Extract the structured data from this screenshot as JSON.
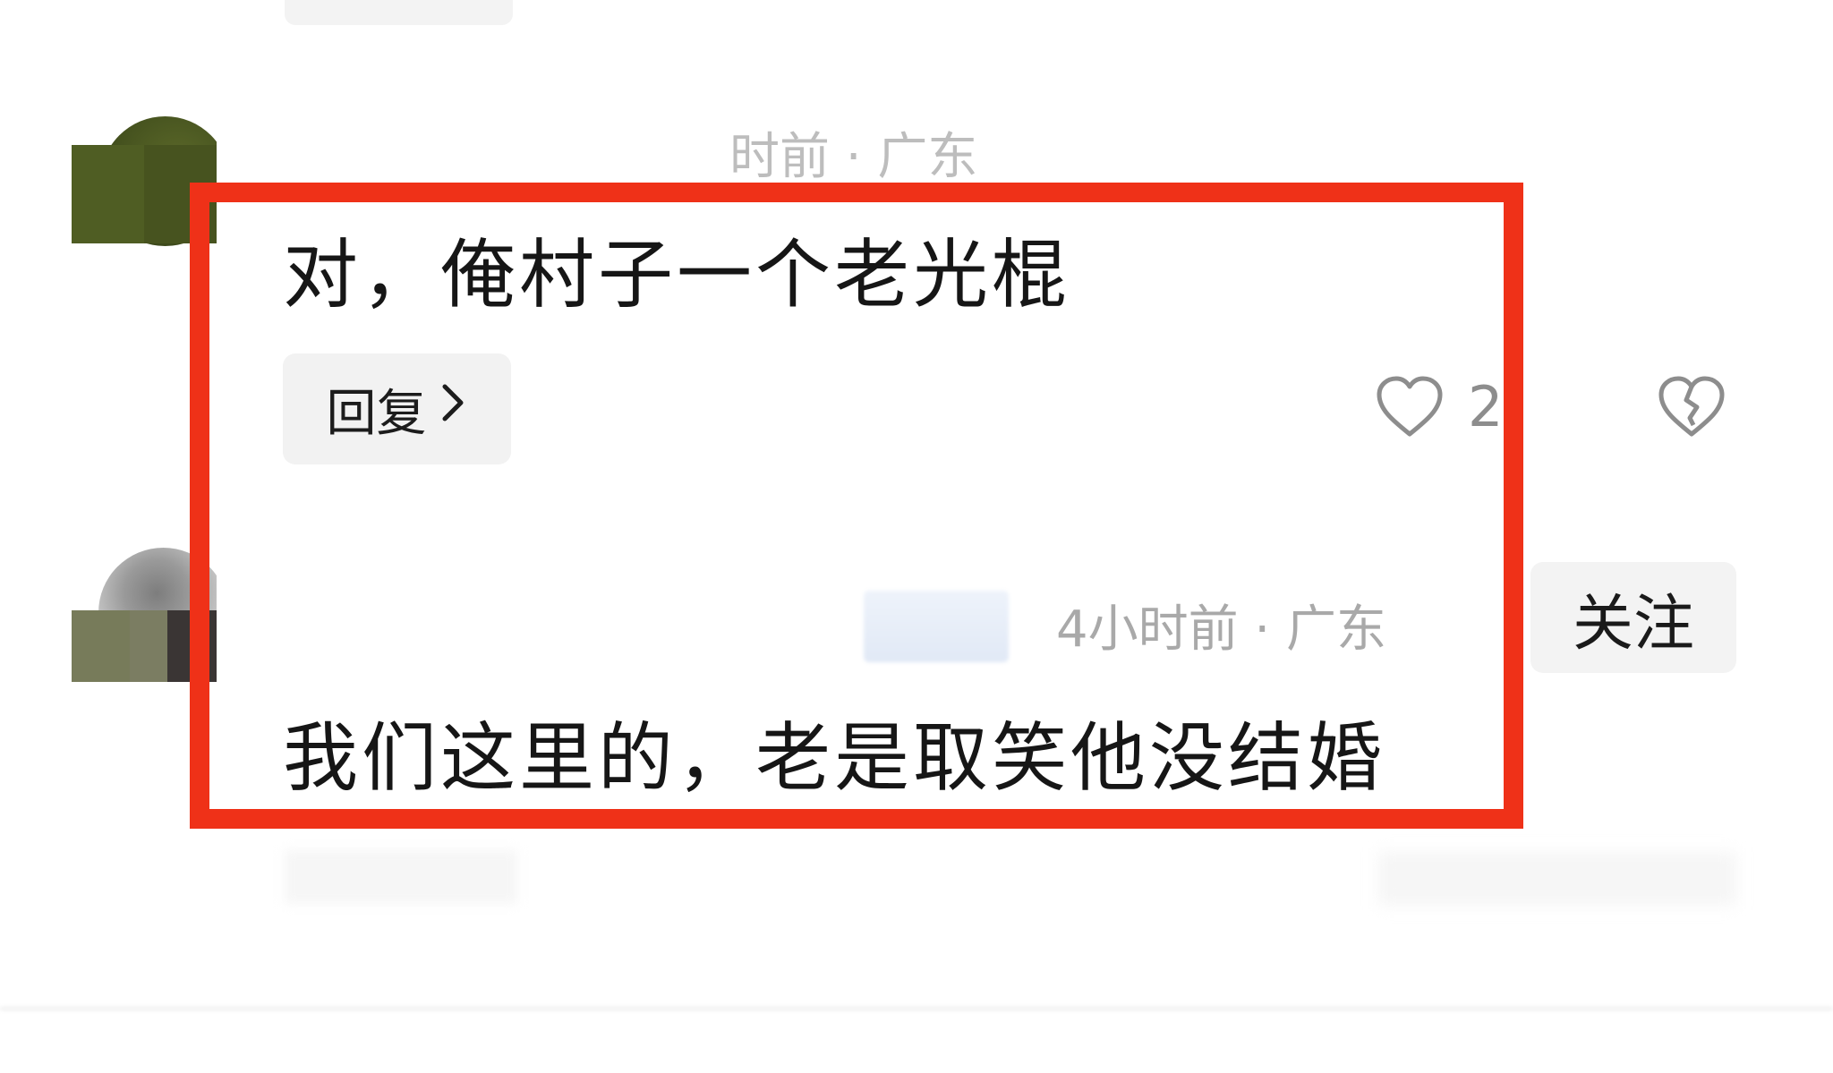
{
  "comments": [
    {
      "meta": "时前 · 广东",
      "text": "对，俺村子一个老光棍",
      "reply_label": "回复",
      "like_count": "2"
    },
    {
      "meta": "4小时前 · 广东",
      "text": "我们这里的，老是取笑他没结婚",
      "follow_label": "关注"
    }
  ],
  "icons": {
    "like": "heart-icon",
    "dislike": "broken-heart-icon",
    "chevron": "chevron-right-icon"
  },
  "colors": {
    "highlight_border": "#ef3118",
    "meta_text": "#a9a9a9",
    "comment_text": "#161616"
  }
}
